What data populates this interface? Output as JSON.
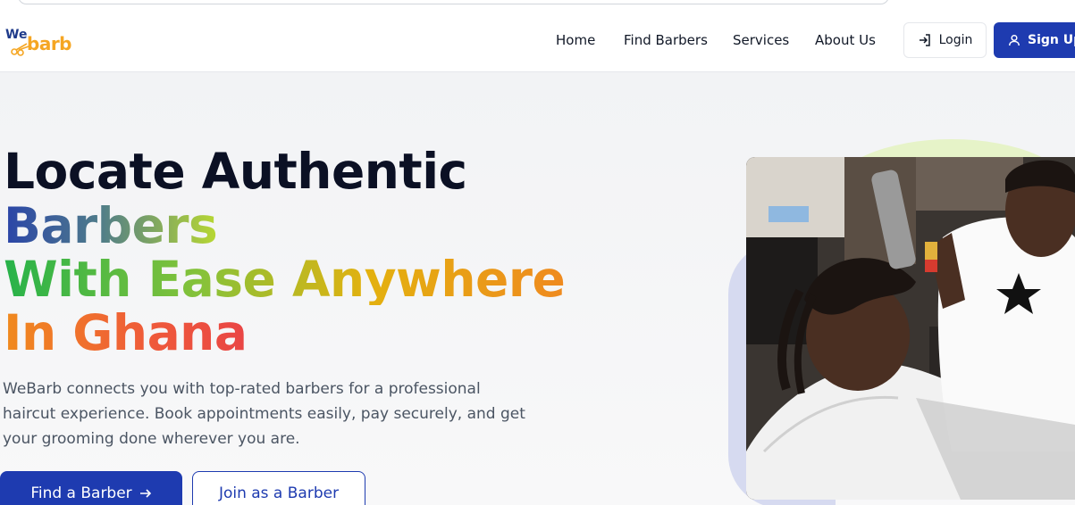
{
  "brand": {
    "we": "We",
    "barb": "barb",
    "accent": "#1e3bb0",
    "logo_orange": "#f5a623"
  },
  "nav": {
    "links": [
      "Home",
      "Find Barbers",
      "Services",
      "About Us"
    ],
    "login": "Login",
    "signup": "Sign Up"
  },
  "hero": {
    "line1": "Locate Authentic",
    "line2": "Barbers",
    "line3": "With Ease Anywhere",
    "line4": "In Ghana",
    "description": "WeBarb connects you with top-rated barbers for a professional haircut experience. Book appointments easily, pay securely, and get your grooming done wherever you are.",
    "cta_primary": "Find a Barber",
    "cta_secondary": "Join as a Barber"
  },
  "icons": {
    "login": "login-arrow-icon",
    "signup": "user-icon",
    "cta": "arrow-right-icon",
    "logo_mark": "scissors-icon"
  }
}
